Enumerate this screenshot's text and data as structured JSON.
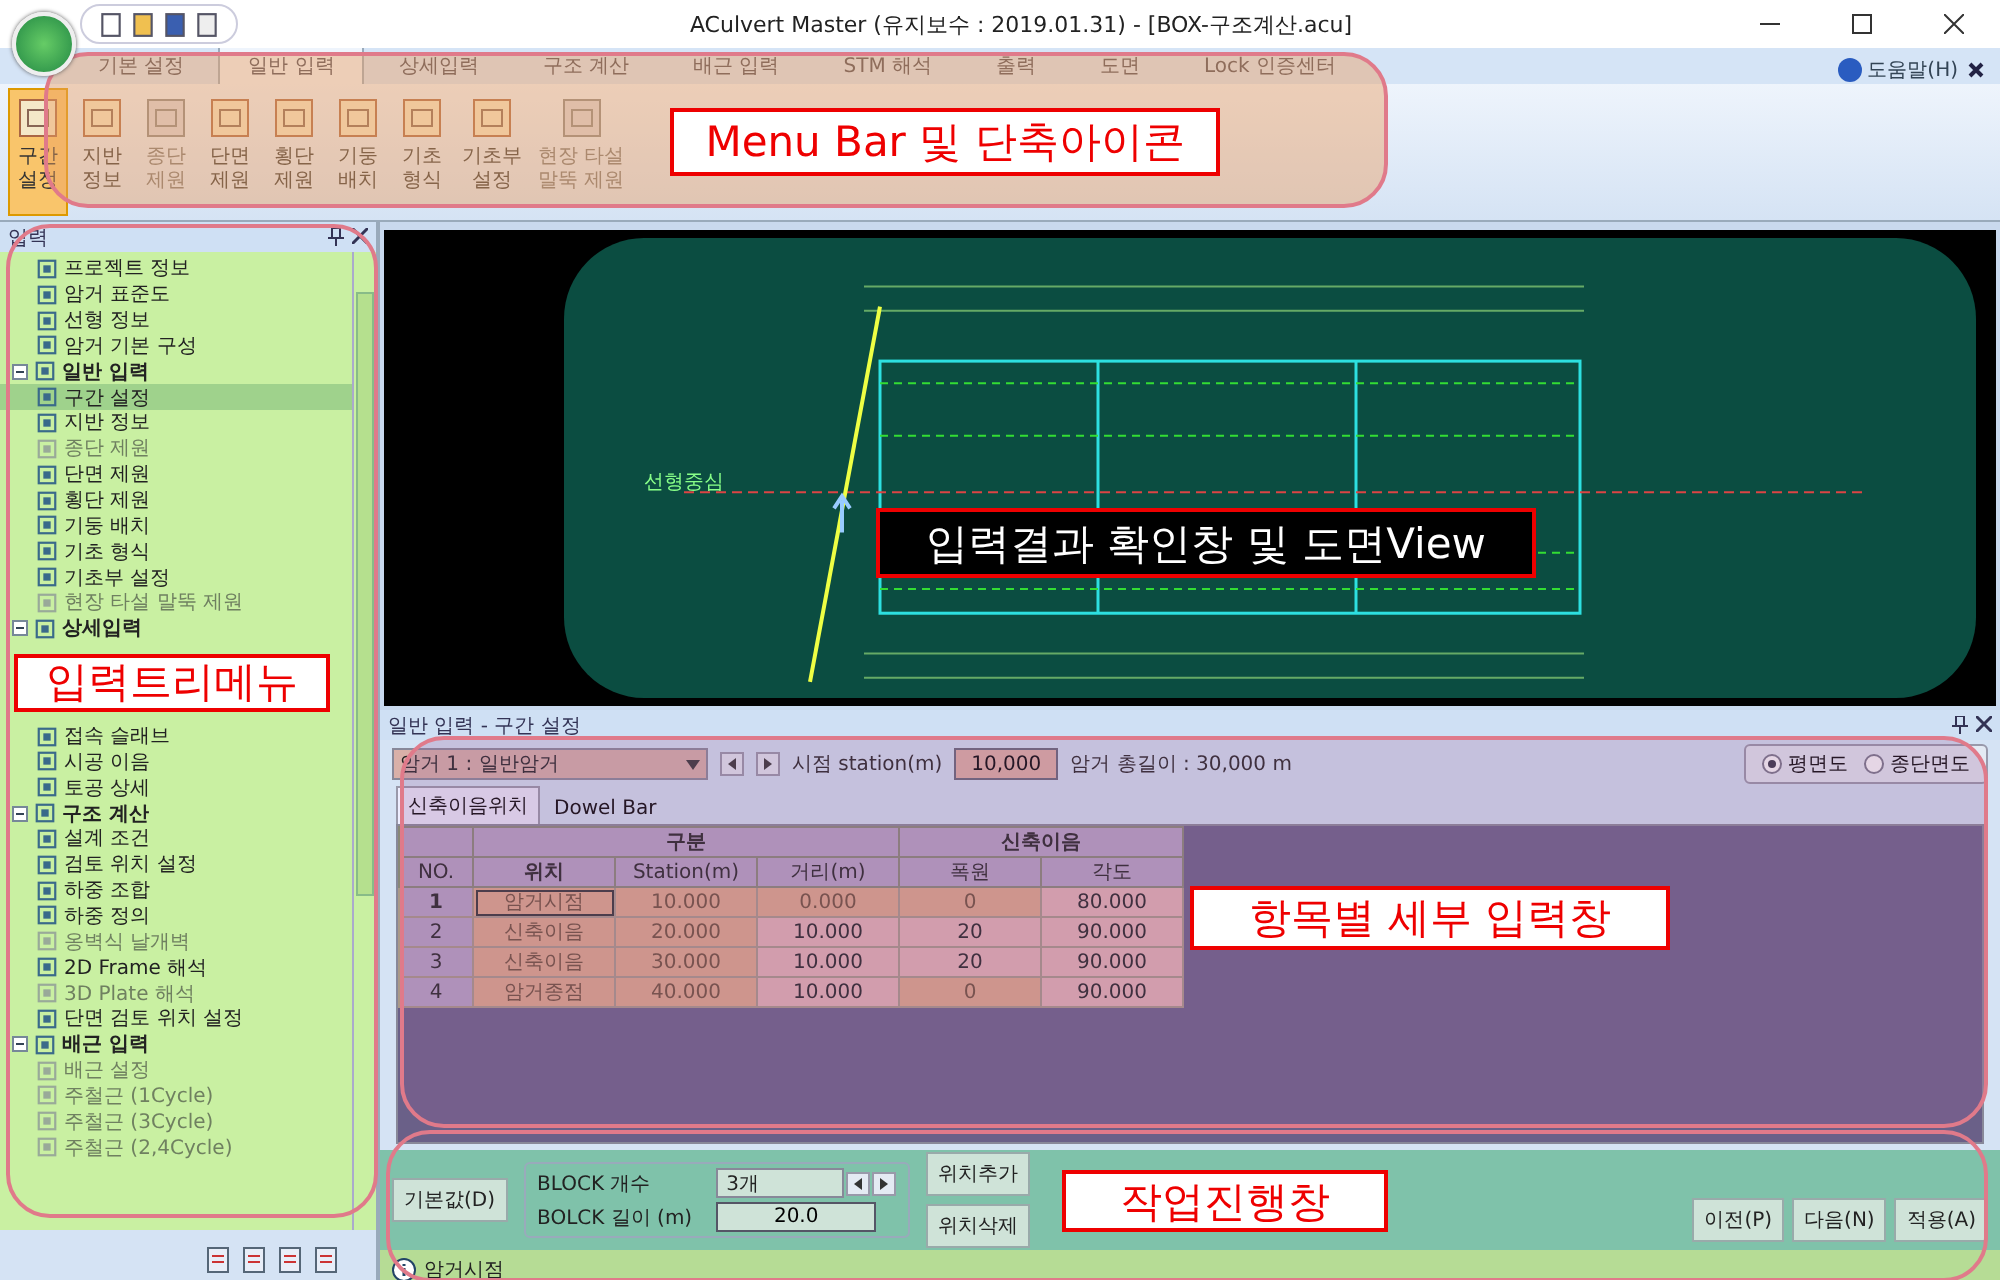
{
  "window": {
    "title": "ACulvert Master  (유지보수 : 2019.01.31) - [BOX-구조계산.acu]"
  },
  "ribbon_tabs": [
    {
      "label": "기본 설정",
      "selected": false
    },
    {
      "label": "일반 입력",
      "selected": true
    },
    {
      "label": "상세입력",
      "selected": false
    },
    {
      "label": "구조 계산",
      "selected": false
    },
    {
      "label": "배근 입력",
      "selected": false
    },
    {
      "label": "STM 해석",
      "selected": false
    },
    {
      "label": "출력",
      "selected": false
    },
    {
      "label": "도면",
      "selected": false
    },
    {
      "label": "Lock 인증센터",
      "selected": false
    }
  ],
  "help": "도움말(H)",
  "ribbon_buttons": [
    {
      "lines": [
        "구간",
        "설정"
      ],
      "selected": true,
      "disabled": false
    },
    {
      "lines": [
        "지반",
        "정보"
      ],
      "selected": false,
      "disabled": false
    },
    {
      "lines": [
        "종단",
        "제원"
      ],
      "selected": false,
      "disabled": true
    },
    {
      "lines": [
        "단면",
        "제원"
      ],
      "selected": false,
      "disabled": false
    },
    {
      "lines": [
        "횡단",
        "제원"
      ],
      "selected": false,
      "disabled": false
    },
    {
      "lines": [
        "기둥",
        "배치"
      ],
      "selected": false,
      "disabled": false
    },
    {
      "lines": [
        "기초",
        "형식"
      ],
      "selected": false,
      "disabled": false
    },
    {
      "lines": [
        "기초부",
        "설정"
      ],
      "selected": false,
      "disabled": false
    },
    {
      "lines": [
        "현장 타설",
        "말뚝 제원"
      ],
      "selected": false,
      "disabled": true
    }
  ],
  "annotations": {
    "ribbon": "Menu Bar 및 단축아이콘",
    "view": "입력결과 확인창 및 도면View",
    "detail": "항목별 세부 입력창",
    "progress": "작업진행창"
  },
  "input_panel": {
    "title": "입력",
    "tree": [
      {
        "label": "프로젝트 정보",
        "selected": false,
        "disabled": false
      },
      {
        "label": "암거 표준도",
        "selected": false,
        "disabled": false
      },
      {
        "label": "선형 정보",
        "selected": false,
        "disabled": false
      },
      {
        "label": "암거 기본 구성",
        "selected": false,
        "disabled": false
      },
      {
        "label": "일반 입력",
        "selected": false,
        "disabled": false,
        "expanded": true,
        "children": [
          {
            "label": "구간 설정",
            "selected": true,
            "disabled": false
          },
          {
            "label": "지반 정보",
            "selected": false,
            "disabled": false
          },
          {
            "label": "종단 제원",
            "selected": false,
            "disabled": true
          },
          {
            "label": "단면 제원",
            "selected": false,
            "disabled": false
          },
          {
            "label": "횡단 제원",
            "selected": false,
            "disabled": false
          },
          {
            "label": "기둥 배치",
            "selected": false,
            "disabled": false
          },
          {
            "label": "기초 형식",
            "selected": false,
            "disabled": false
          },
          {
            "label": "기초부 설정",
            "selected": false,
            "disabled": false
          },
          {
            "label": "현장 타설 말뚝 제원",
            "selected": false,
            "disabled": true
          }
        ]
      },
      {
        "label": "상세입력",
        "selected": false,
        "disabled": false,
        "expanded": true,
        "callout": "입력트리메뉴",
        "children": [
          {
            "label": "접속 슬래브",
            "selected": false,
            "disabled": false
          },
          {
            "label": "시공 이음",
            "selected": false,
            "disabled": false
          },
          {
            "label": "토공 상세",
            "selected": false,
            "disabled": false
          }
        ]
      },
      {
        "label": "구조 계산",
        "selected": false,
        "disabled": false,
        "expanded": true,
        "children": [
          {
            "label": "설계 조건",
            "selected": false,
            "disabled": false
          },
          {
            "label": "검토 위치 설정",
            "selected": false,
            "disabled": false
          },
          {
            "label": "하중 조합",
            "selected": false,
            "disabled": false
          },
          {
            "label": "하중 정의",
            "selected": false,
            "disabled": false
          },
          {
            "label": "옹벽식 날개벽",
            "selected": false,
            "disabled": true
          },
          {
            "label": "2D Frame 해석",
            "selected": false,
            "disabled": false
          },
          {
            "label": "3D Plate 해석",
            "selected": false,
            "disabled": true
          },
          {
            "label": "단면 검토 위치 설정",
            "selected": false,
            "disabled": false
          }
        ]
      },
      {
        "label": "배근 입력",
        "selected": false,
        "disabled": false,
        "expanded": true,
        "children": [
          {
            "label": "배근 설정",
            "selected": false,
            "disabled": true
          },
          {
            "label": "주철근 (1Cycle)",
            "selected": false,
            "disabled": true
          },
          {
            "label": "주철근 (3Cycle)",
            "selected": false,
            "disabled": true
          },
          {
            "label": "주철근 (2,4Cycle)",
            "selected": false,
            "disabled": true
          }
        ]
      }
    ]
  },
  "drawing": {
    "label": "선형중심"
  },
  "detail_panel": {
    "title": "일반 입력 - 구간 설정",
    "culvert_select": "암거 1 : 일반암거",
    "start_label": "시점 station(m)",
    "start_value": "10,000",
    "total_length": "암거 총길이 : 30,000 m",
    "view_options": [
      {
        "label": "평면도",
        "selected": true
      },
      {
        "label": "종단면도",
        "selected": false
      }
    ],
    "tabs": [
      {
        "label": "신축이음위치",
        "selected": true
      },
      {
        "label": "Dowel Bar",
        "selected": false
      }
    ],
    "table": {
      "row_header": "NO.",
      "groups": [
        {
          "label": "구분",
          "columns": [
            "위치",
            "Station(m)",
            "거리(m)"
          ]
        },
        {
          "label": "신축이음",
          "columns": [
            "폭원",
            "각도"
          ]
        }
      ],
      "rows": [
        {
          "no": "1",
          "selected": true,
          "cells": [
            {
              "text": "암거시점",
              "locked": true
            },
            {
              "text": "10.000",
              "locked": true
            },
            {
              "text": "0.000",
              "locked": true
            },
            {
              "text": "0",
              "locked": true
            },
            {
              "text": "80.000",
              "locked": false
            }
          ]
        },
        {
          "no": "2",
          "selected": false,
          "cells": [
            {
              "text": "신축이음",
              "locked": true
            },
            {
              "text": "20.000",
              "locked": true
            },
            {
              "text": "10.000",
              "locked": false
            },
            {
              "text": "20",
              "locked": false
            },
            {
              "text": "90.000",
              "locked": false
            }
          ]
        },
        {
          "no": "3",
          "selected": false,
          "cells": [
            {
              "text": "신축이음",
              "locked": true
            },
            {
              "text": "30.000",
              "locked": true
            },
            {
              "text": "10.000",
              "locked": false
            },
            {
              "text": "20",
              "locked": false
            },
            {
              "text": "90.000",
              "locked": false
            }
          ]
        },
        {
          "no": "4",
          "selected": false,
          "cells": [
            {
              "text": "암거종점",
              "locked": true
            },
            {
              "text": "40.000",
              "locked": true
            },
            {
              "text": "10.000",
              "locked": false
            },
            {
              "text": "0",
              "locked": true
            },
            {
              "text": "90.000",
              "locked": false
            }
          ]
        }
      ]
    }
  },
  "progress_panel": {
    "default_button": "기본값(D)",
    "block_count_label": "BLOCK 개수",
    "block_count": "3개",
    "block_length_label": "BOLCK 길이 (m)",
    "block_length": "20.0",
    "add_button": "위치추가",
    "delete_button": "위치삭제",
    "nav_buttons": [
      "이전(P)",
      "다음(N)",
      "적용(A)"
    ]
  },
  "status_bar": {
    "text": "암거시점"
  }
}
